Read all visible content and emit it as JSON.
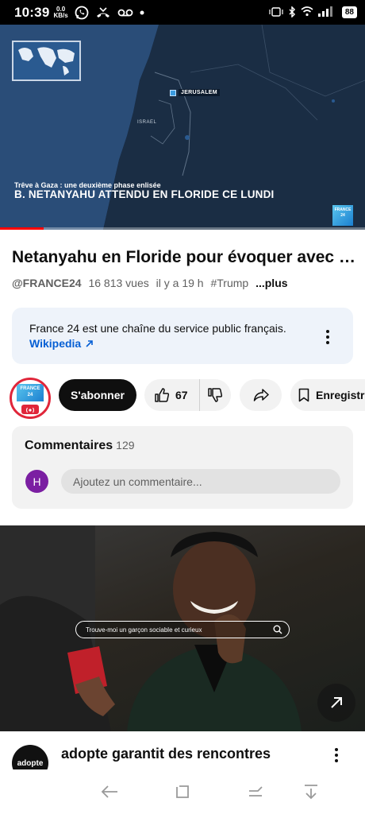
{
  "status_bar": {
    "time": "10:39",
    "net_speed_value": "0.0",
    "net_speed_unit": "KB/s",
    "icons": [
      "whatsapp-icon",
      "missed-call-icon",
      "voicemail-icon",
      "dot-icon",
      "vibrate-icon",
      "bluetooth-icon",
      "wifi-icon",
      "signal-icon"
    ],
    "battery": "88"
  },
  "player": {
    "city_label": "JERUSALEM",
    "country_label": "ISRAEL",
    "chyron_sub": "Trêve à Gaza : une deuxième phase enlisée",
    "chyron_main": "B. NETANYAHU ATTENDU EN FLORIDE CE LUNDI",
    "logo_line1": "FRANCE",
    "logo_line2": "24",
    "progress": 0.12,
    "colors": {
      "progress": "#ff0000",
      "background": "#1d3556"
    }
  },
  "video": {
    "title": "Netanyahu en Floride pour évoquer avec Trump la suite du cessez-le-feu",
    "channel_handle": "@FRANCE24",
    "views": "16 813 vues",
    "age": "il y a 19 h",
    "hashtag": "#Trump",
    "more": "...plus"
  },
  "info_card": {
    "text": "France 24 est une chaîne du service public français.",
    "link": "Wikipedia"
  },
  "actions": {
    "subscribe": "S'abonner",
    "likes": "67",
    "save": "Enregistrer",
    "avatar_line1": "FRANCE",
    "avatar_line2": "24"
  },
  "comments": {
    "title": "Commentaires",
    "count": "129",
    "avatar_initial": "H",
    "placeholder": "Ajoutez un commentaire..."
  },
  "ad": {
    "search_text": "Trouve-moi un garçon sociable et curieux",
    "logo_text": "adopte",
    "title": "adopte garantit des rencontres"
  },
  "navbar": {
    "icons": [
      "back-icon",
      "home-icon",
      "recents-icon",
      "notifications-down-icon"
    ]
  }
}
